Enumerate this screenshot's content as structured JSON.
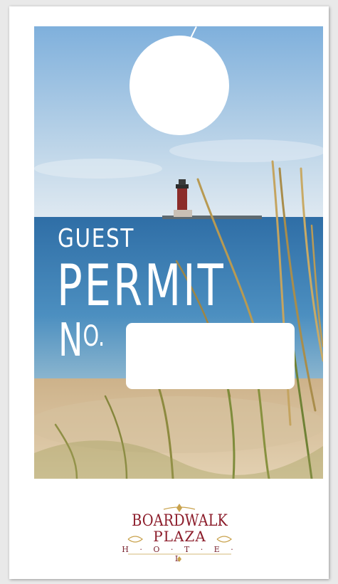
{
  "permit": {
    "guest_label": "GUEST",
    "permit_label": "PERMIT",
    "number_label_n": "N",
    "number_label_o": "O."
  },
  "logo": {
    "line1": "BOARDWALK",
    "line2": "PLAZA",
    "line3": "H · O · T · E · L"
  },
  "colors": {
    "sky": "#8ab4d8",
    "sea": "#3f7fb3",
    "sand": "#d8c09b",
    "brand_red": "#8c1d2b",
    "brand_gold": "#c9a24c"
  },
  "icons": [
    "lighthouse-icon",
    "dune-grass-icon",
    "ornament-icon"
  ]
}
